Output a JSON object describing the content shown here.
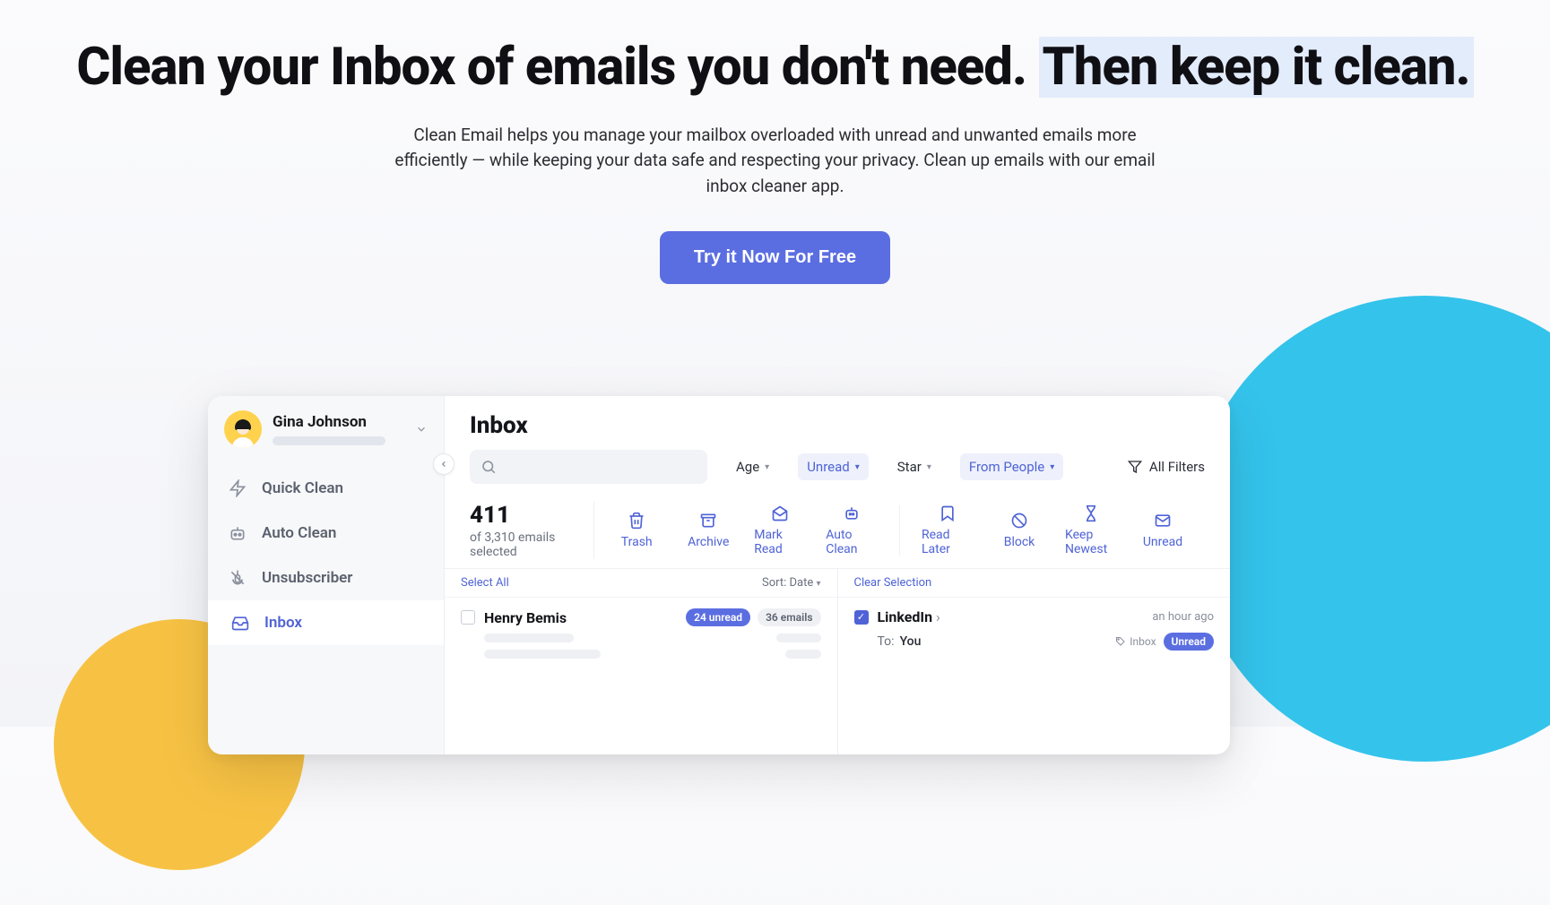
{
  "hero": {
    "title_pre": "Clean your Inbox of emails you don't need. ",
    "title_hl": "Then keep it clean.",
    "subtitle": "Clean Email helps you manage your mailbox overloaded with unread and unwanted emails more efficiently — while keeping your data safe and respecting your privacy. Clean up emails with our email inbox cleaner app.",
    "cta": "Try it Now For Free"
  },
  "sidebar": {
    "user_name": "Gina Johnson",
    "items": [
      {
        "label": "Quick Clean",
        "icon": "bolt"
      },
      {
        "label": "Auto Clean",
        "icon": "robot"
      },
      {
        "label": "Unsubscriber",
        "icon": "mute"
      },
      {
        "label": "Inbox",
        "icon": "inbox",
        "active": true
      }
    ]
  },
  "main": {
    "title": "Inbox",
    "filters": {
      "age": "Age",
      "unread": "Unread",
      "star": "Star",
      "from_people": "From People",
      "all_filters": "All Filters"
    },
    "count": {
      "num": "411",
      "sub": "of 3,310 emails selected"
    },
    "tools": {
      "trash": "Trash",
      "archive": "Archive",
      "mark_read": "Mark Read",
      "auto_clean": "Auto Clean",
      "read_later": "Read Later",
      "block": "Block",
      "keep_newest": "Keep Newest",
      "unread": "Unread"
    },
    "left_pane": {
      "select_all": "Select All",
      "sort_label": "Sort: Date",
      "sender": "Henry Bemis",
      "badge_unread": "24 unread",
      "badge_count": "36 emails"
    },
    "right_pane": {
      "clear_selection": "Clear Selection",
      "sender": "LinkedIn",
      "time": "an hour ago",
      "to_label": "To:",
      "to_value": "You",
      "tag_inbox": "Inbox",
      "tag_unread": "Unread"
    }
  }
}
